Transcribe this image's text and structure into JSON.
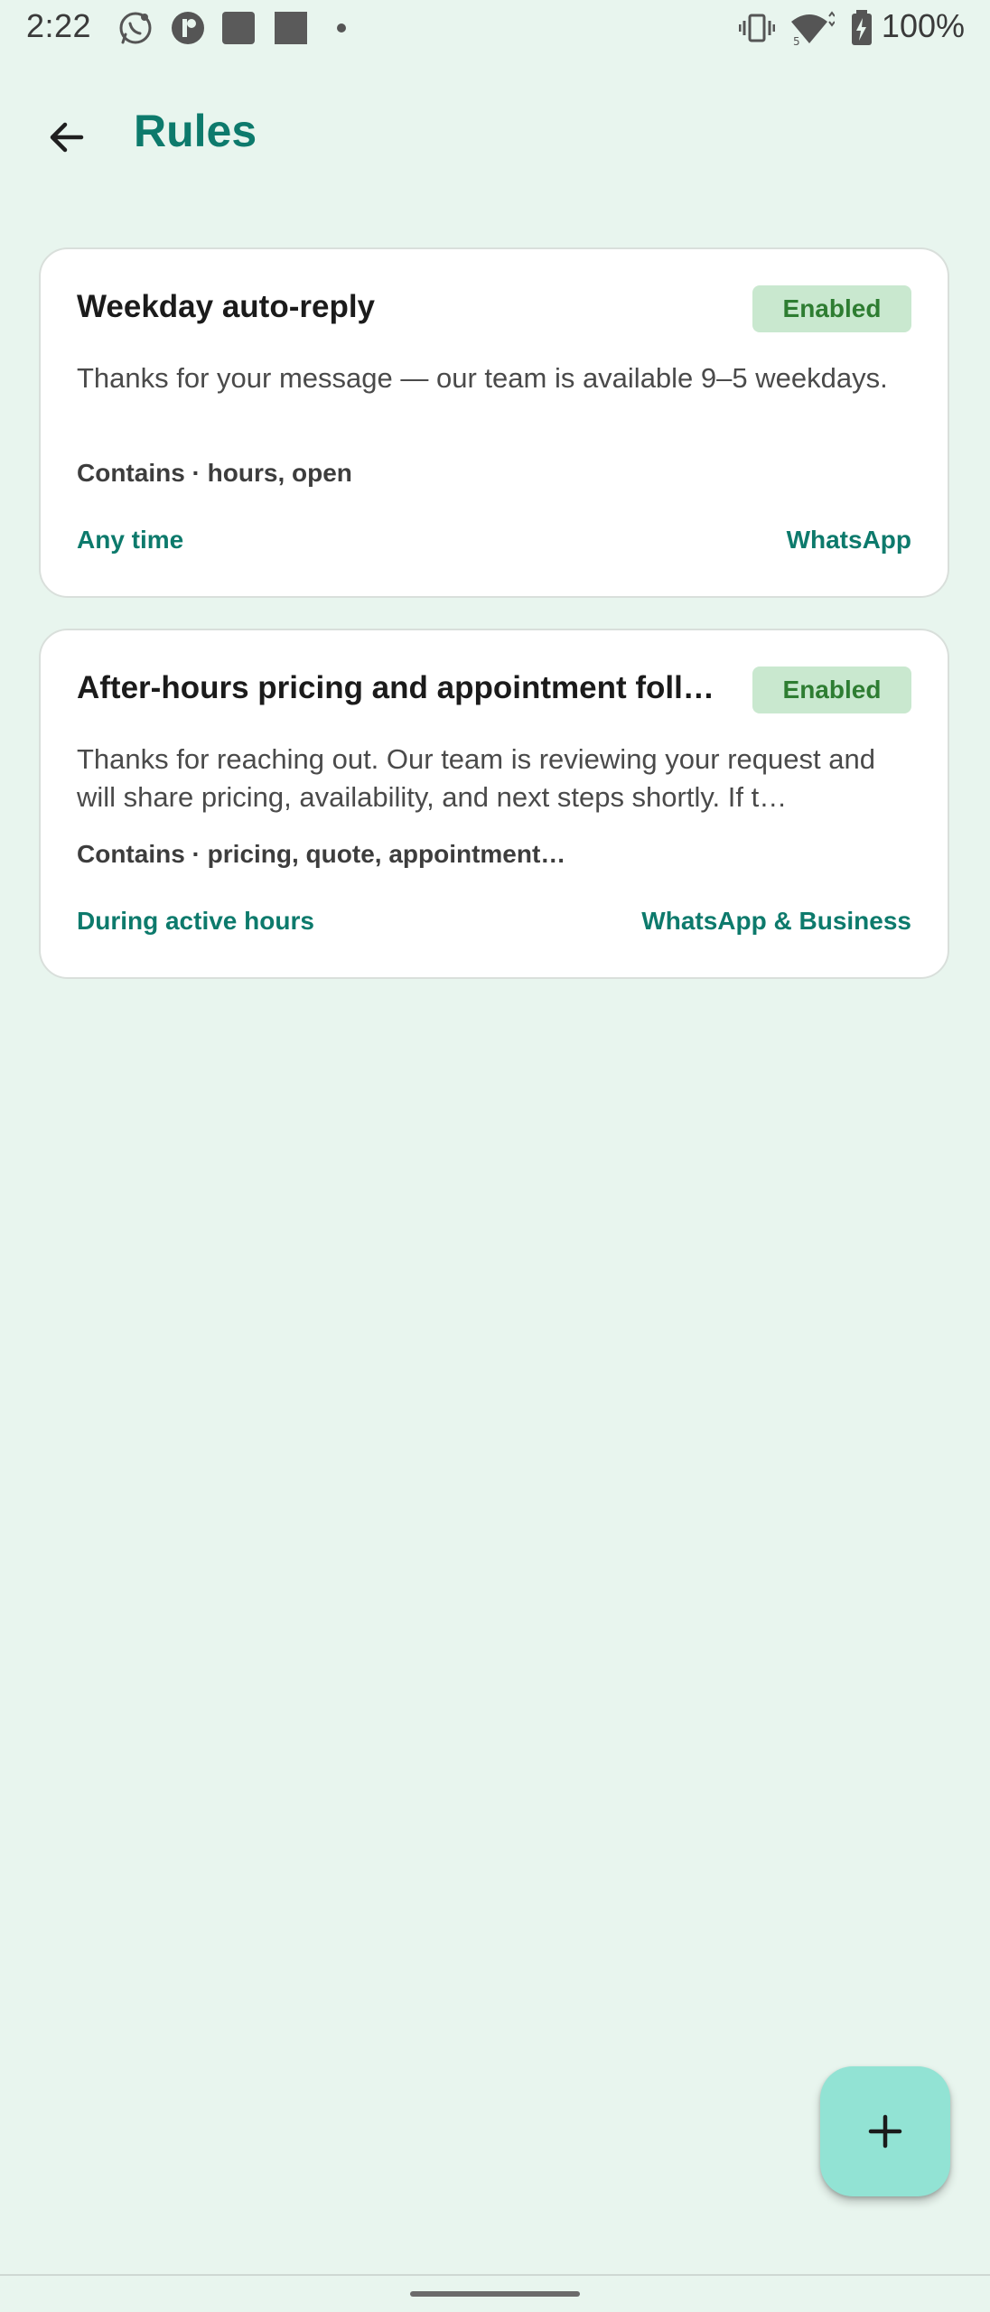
{
  "status_bar": {
    "time": "2:22",
    "battery": "100%",
    "icons": [
      "whatsapp-business-icon",
      "app-icon",
      "photo-icon",
      "image-icon",
      "notification-dot-icon",
      "vibrate-icon",
      "wifi-icon",
      "battery-charging-icon"
    ]
  },
  "app_bar": {
    "title": "Rules",
    "back_icon": "arrow-back-icon"
  },
  "rules": [
    {
      "title": "Weekday auto-reply",
      "status": "Enabled",
      "message": "Thanks for your message — our team is available 9–5 weekdays.",
      "keywords": "Contains · hours, open",
      "schedule": "Any time",
      "channel": "WhatsApp"
    },
    {
      "title": "After-hours pricing and appointment follo…",
      "status": "Enabled",
      "message": "Thanks for reaching out. Our team is reviewing your request and will share pricing, availability, and next steps shortly. If t…",
      "keywords": "Contains · pricing, quote, appointment…",
      "schedule": "During active hours",
      "channel": "WhatsApp & Business"
    }
  ],
  "fab": {
    "icon": "add-icon"
  },
  "colors": {
    "background": "#e8f5ee",
    "accent": "#0d7a6c",
    "status_pill_bg": "#c9e8cf",
    "status_pill_text": "#2e7d32",
    "fab_bg": "#92e3d4"
  }
}
